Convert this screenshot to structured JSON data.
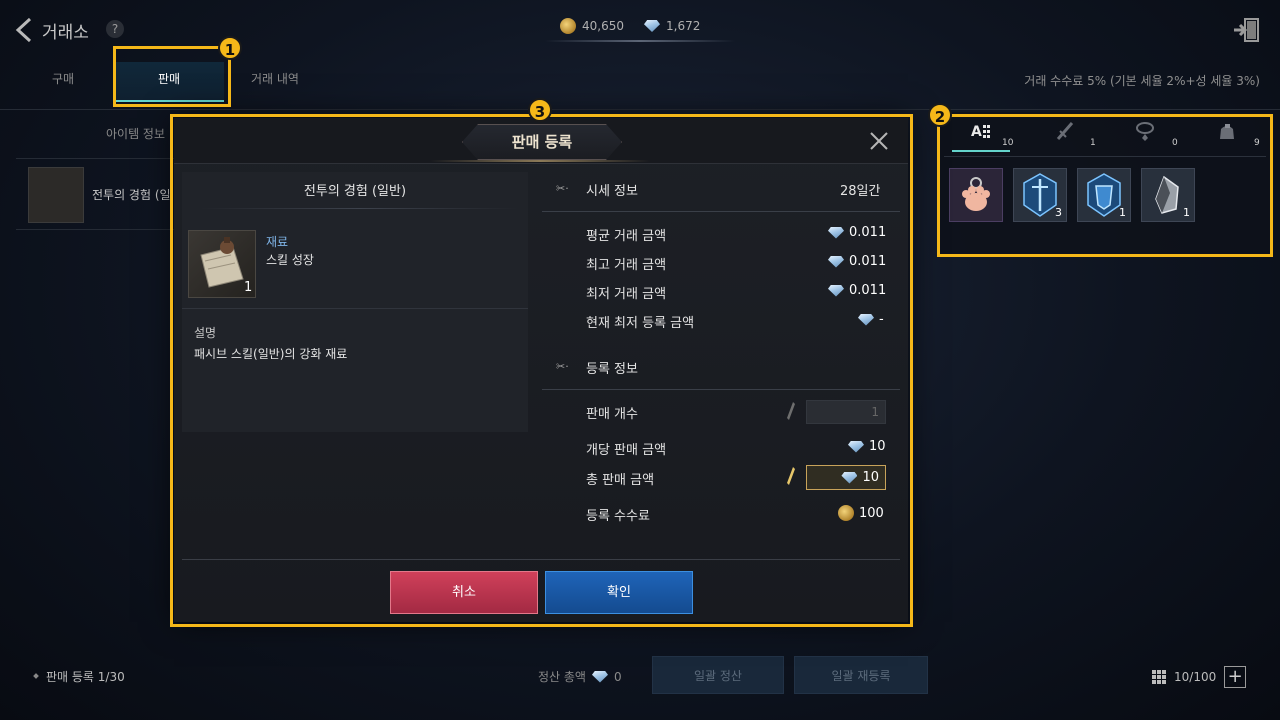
{
  "header": {
    "title": "거래소",
    "help": "?",
    "gold": "40,650",
    "gems": "1,672"
  },
  "tabs": [
    {
      "label": "구매"
    },
    {
      "label": "판매",
      "active": true
    },
    {
      "label": "거래 내역"
    }
  ],
  "fee_info": "거래 수수료 5% (기본 세율 2%+성 세율 3%)",
  "list": {
    "header": "아이템 정보",
    "row_name": "전투의 경험 (일"
  },
  "badges": [
    "1",
    "2",
    "3"
  ],
  "inventory": {
    "tabs": [
      {
        "icon": "all-items-icon",
        "count": "10"
      },
      {
        "icon": "weapon-icon",
        "count": "1"
      },
      {
        "icon": "accessory-icon",
        "count": "0"
      },
      {
        "icon": "material-bag-icon",
        "count": "9"
      }
    ],
    "slots": [
      {
        "icon": "paw-charm-icon",
        "count": ""
      },
      {
        "icon": "blue-crystal-icon",
        "count": "3"
      },
      {
        "icon": "blue-armor-crystal-icon",
        "count": "1"
      },
      {
        "icon": "silver-ore-icon",
        "count": "1"
      }
    ]
  },
  "modal": {
    "title": "판매 등록",
    "item": {
      "name": "전투의 경험 (일반)",
      "quantity": "1",
      "type": "재료",
      "subtype": "스킬 성장",
      "desc_label": "설명",
      "description": "패시브 스킬(일반)의 강화 재료"
    },
    "market": {
      "heading": "시세 정보",
      "period": "28일간",
      "rows": [
        {
          "label": "평균 거래 금액",
          "value": "0.011"
        },
        {
          "label": "최고 거래 금액",
          "value": "0.011"
        },
        {
          "label": "최저 거래 금액",
          "value": "0.011"
        },
        {
          "label": "현재 최저 등록 금액",
          "value": "-"
        }
      ]
    },
    "registration": {
      "heading": "등록 정보",
      "quantity_label": "판매 개수",
      "quantity_value": "1",
      "unit_price_label": "개당 판매 금액",
      "unit_price_value": "10",
      "total_label": "총 판매 금액",
      "total_value": "10",
      "fee_label": "등록 수수료",
      "fee_value": "100"
    },
    "cancel_label": "취소",
    "confirm_label": "확인"
  },
  "footer": {
    "sell_count": "판매 등록 1/30",
    "settle_label": "정산 총액",
    "settle_value": "0",
    "bulk_settle": "일괄 정산",
    "bulk_reregister": "일괄 재등록",
    "capacity": "10/100",
    "add": "+"
  },
  "colors": {
    "highlight": "#f5b819",
    "tab_accent": "#64d4cc",
    "cancel": "#c0394f",
    "confirm": "#1b5aa8"
  }
}
